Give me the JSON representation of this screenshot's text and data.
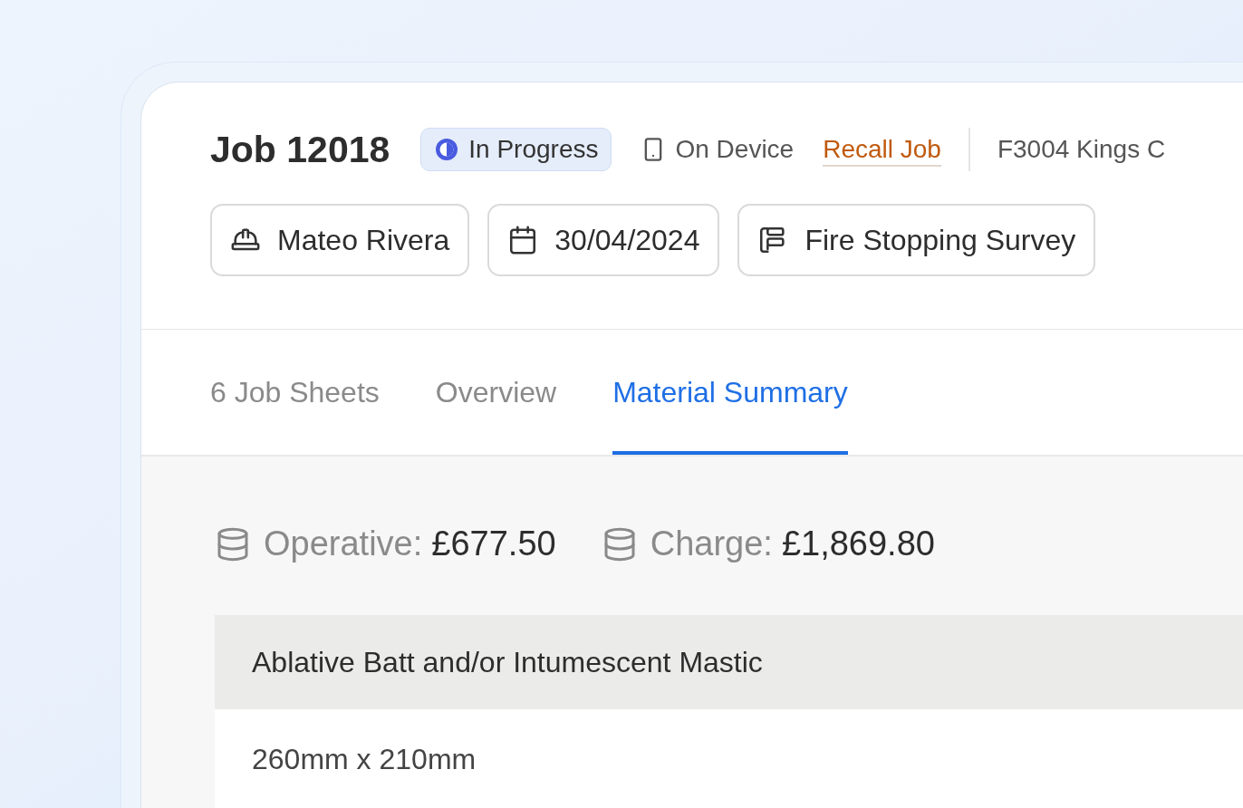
{
  "job": {
    "title": "Job 12018",
    "status": {
      "kind": "in_progress",
      "label": "In Progress"
    },
    "location": "On Device",
    "recall_link": "Recall Job",
    "address": "F3004 Kings C"
  },
  "chips": [
    {
      "kind": "operative",
      "label": "Mateo Rivera"
    },
    {
      "kind": "date",
      "label": "30/04/2024"
    },
    {
      "kind": "template",
      "label": "Fire Stopping Survey"
    }
  ],
  "tabs": [
    {
      "label": "6 Job Sheets",
      "selected": false
    },
    {
      "label": "Overview",
      "selected": false
    },
    {
      "label": "Material Summary",
      "selected": true
    }
  ],
  "summary": [
    {
      "label": "Operative:",
      "value": "£677.50"
    },
    {
      "label": "Charge:",
      "value": "£1,869.80"
    }
  ],
  "table": {
    "group": "Ablative Batt and/or Intumescent Mastic",
    "rows": [
      "260mm x 210mm"
    ]
  }
}
